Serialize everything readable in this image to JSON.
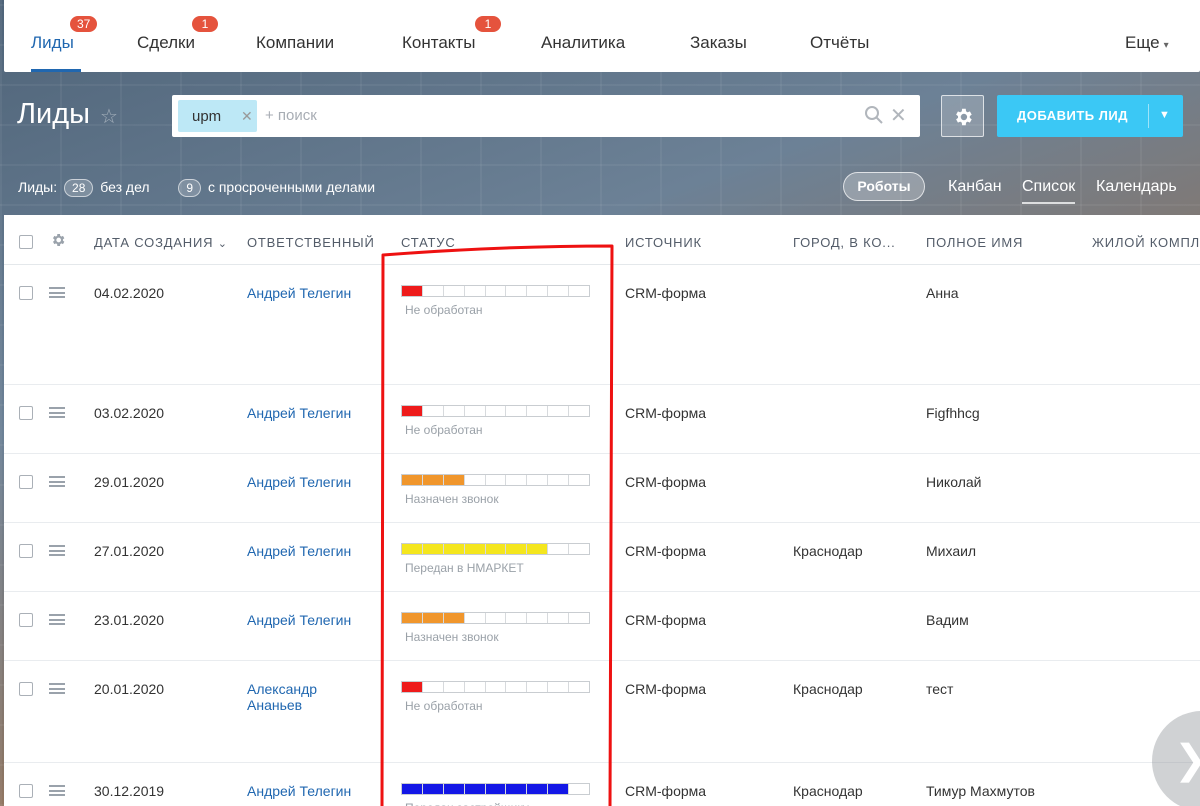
{
  "nav": {
    "items": [
      {
        "label": "Лиды",
        "badge": "37"
      },
      {
        "label": "Сделки",
        "badge": "1"
      },
      {
        "label": "Компании"
      },
      {
        "label": "Контакты",
        "badge": "1"
      },
      {
        "label": "Аналитика"
      },
      {
        "label": "Заказы"
      },
      {
        "label": "Отчёты"
      }
    ],
    "more_label": "Еще"
  },
  "header": {
    "title": "Лиды",
    "filter_tag": "upm",
    "search_placeholder": "+ поиск",
    "add_button_label": "ДОБАВИТЬ ЛИД"
  },
  "counters": {
    "prefix": "Лиды:",
    "no_tasks_count": "28",
    "no_tasks_label": "без дел",
    "overdue_count": "9",
    "overdue_label": "с просроченными делами"
  },
  "views": {
    "robots_label": "Роботы",
    "tabs": [
      "Канбан",
      "Список",
      "Календарь"
    ],
    "active": "Список"
  },
  "grid": {
    "columns": [
      "ДАТА СОЗДАНИЯ",
      "ОТВЕТСТВЕННЫЙ",
      "СТАТУС",
      "ИСТОЧНИК",
      "ГОРОД, В КО...",
      "ПОЛНОЕ ИМЯ",
      "ЖИЛОЙ КОМПЛЕ"
    ],
    "sort_column": "ДАТА СОЗДАНИЯ",
    "status_palette": {
      "Не обработан": "#ee1b1b",
      "Назначен звонок": "#f0962c",
      "Передан в НМАРКЕТ": "#f4e61e",
      "Передан застройщику": "#1317e6"
    },
    "progress_segments": 9,
    "rows": [
      {
        "date": "04.02.2020",
        "responsible": "Андрей Телегин",
        "status": "Не обработан",
        "progress_filled": 1,
        "source": "CRM-форма",
        "city": "",
        "name": "Анна"
      },
      {
        "date": "03.02.2020",
        "responsible": "Андрей Телегин",
        "status": "Не обработан",
        "progress_filled": 1,
        "source": "CRM-форма",
        "city": "",
        "name": "Figfhhcg"
      },
      {
        "date": "29.01.2020",
        "responsible": "Андрей Телегин",
        "status": "Назначен звонок",
        "progress_filled": 3,
        "source": "CRM-форма",
        "city": "",
        "name": "Николай"
      },
      {
        "date": "27.01.2020",
        "responsible": "Андрей Телегин",
        "status": "Передан в НМАРКЕТ",
        "progress_filled": 7,
        "source": "CRM-форма",
        "city": "Краснодар",
        "name": "Михаил"
      },
      {
        "date": "23.01.2020",
        "responsible": "Андрей Телегин",
        "status": "Назначен звонок",
        "progress_filled": 3,
        "source": "CRM-форма",
        "city": "",
        "name": "Вадим"
      },
      {
        "date": "20.01.2020",
        "responsible": "Александр Ананьев",
        "status": "Не обработан",
        "progress_filled": 1,
        "source": "CRM-форма",
        "city": "Краснодар",
        "name": "тест"
      },
      {
        "date": "30.12.2019",
        "responsible": "Андрей Телегин",
        "status": "Передан застройщику",
        "progress_filled": 8,
        "source": "CRM-форма",
        "city": "Краснодар",
        "name": "Тимур Махмутов"
      }
    ]
  },
  "colors": {
    "accent": "#2067b0",
    "add_button": "#3bc8f5",
    "badge": "#e5533d",
    "annotation": "#ee1111"
  }
}
